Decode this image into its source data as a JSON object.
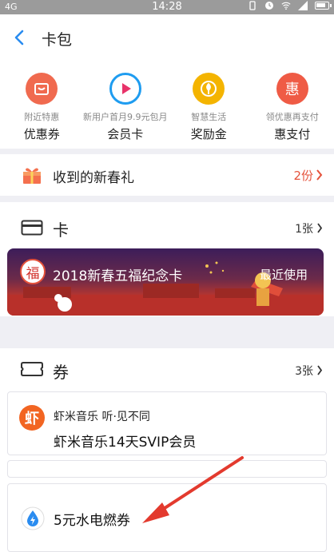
{
  "status_bar": {
    "network": "4G",
    "time": "14:28"
  },
  "header": {
    "title": "卡包"
  },
  "entries": [
    {
      "sub": "附近特惠",
      "label": "优惠券",
      "icon": "coupon-icon",
      "color": "#f06a4f"
    },
    {
      "sub": "新用户首月9.9元包月",
      "label": "会员卡",
      "icon": "play-icon",
      "color": "#1e9cf0"
    },
    {
      "sub": "智慧生活",
      "label": "奖励金",
      "icon": "reward-icon",
      "color": "#f4b400"
    },
    {
      "sub": "领优惠再支付",
      "label": "惠支付",
      "icon": "hui-icon",
      "color": "#ef5b45",
      "glyph": "惠"
    }
  ],
  "gift": {
    "text": "收到的新春礼",
    "count": "2份"
  },
  "cards": {
    "title": "卡",
    "count": "1张",
    "banner_title": "2018新春五福纪念卡",
    "banner_tag": "最近使用",
    "fu_glyph": "福"
  },
  "coupons": {
    "title": "券",
    "count": "3张",
    "items": [
      {
        "brand": "虾米音乐  听·见不同",
        "title": "虾米音乐14天SVIP会员",
        "glyph": "虾"
      },
      {
        "title": "5元水电燃券"
      }
    ]
  },
  "colors": {
    "accent_red": "#e5523b",
    "back_blue": "#2a8cf0"
  }
}
